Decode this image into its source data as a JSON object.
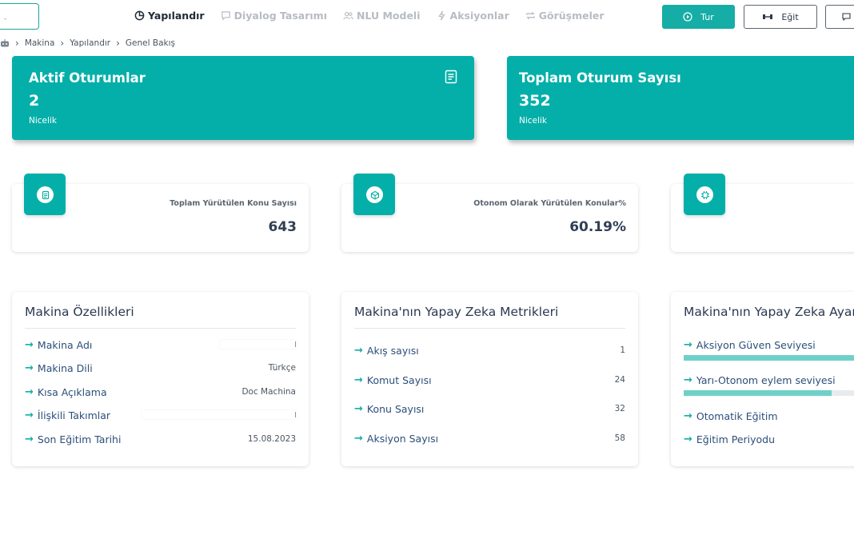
{
  "top_input": {
    "value": "-"
  },
  "nav": {
    "items": [
      {
        "label": "Yapılandır",
        "icon": "pie-chart-icon",
        "active": true
      },
      {
        "label": "Diyalog Tasarımı",
        "icon": "chat-bubble-icon",
        "active": false
      },
      {
        "label": "NLU Modeli",
        "icon": "users-icon",
        "active": false
      },
      {
        "label": "Aksiyonlar",
        "icon": "lightning-icon",
        "active": false
      },
      {
        "label": "Görüşmeler",
        "icon": "repeat-icon",
        "active": false
      }
    ]
  },
  "toolbar": {
    "run_label": "Tur",
    "train_label": "Eğit"
  },
  "breadcrumb": [
    "Makina",
    "Yapılandır",
    "Genel Bakış"
  ],
  "stats": [
    {
      "title": "Aktif Oturumlar",
      "value": "2",
      "unit": "Nicelik"
    },
    {
      "title": "Toplam Oturum Sayısı",
      "value": "352",
      "unit": "Nicelik"
    }
  ],
  "metrics": [
    {
      "label": "Toplam Yürütülen Konu Sayısı",
      "value": "643",
      "icon": "document-icon"
    },
    {
      "label": "Otonom Olarak Yürütülen Konular%",
      "value": "60.19%",
      "icon": "cube-icon"
    },
    {
      "label": "",
      "value": "",
      "icon": "chip-icon"
    }
  ],
  "properties": {
    "title": "Makina Özellikleri",
    "rows": [
      {
        "label": "Makina Adı",
        "value": ""
      },
      {
        "label": "Makina Dili",
        "value": "Türkçe"
      },
      {
        "label": "Kısa Açıklama",
        "value": "Doc Machina"
      },
      {
        "label": "İlişkili Takımlar",
        "value": ""
      },
      {
        "label": "Son Eğitim Tarihi",
        "value": "15.08.2023"
      }
    ]
  },
  "ai_metrics": {
    "title": "Makina'nın Yapay Zeka Metrikleri",
    "rows": [
      {
        "label": "Akış sayısı",
        "value": "1"
      },
      {
        "label": "Komut Sayısı",
        "value": "24"
      },
      {
        "label": "Konu Sayısı",
        "value": "32"
      },
      {
        "label": "Aksiyon Sayısı",
        "value": "58"
      }
    ]
  },
  "ai_settings": {
    "title": "Makina'nın Yapay Zeka Ayarları",
    "rows": [
      {
        "label": "Aksiyon Güven Seviyesi",
        "level": 1.0
      },
      {
        "label": "Yarı-Otonom eylem seviyesi",
        "level": 0.81
      },
      {
        "label": "Otomatik Eğitim"
      },
      {
        "label": "Eğitim Periyodu"
      }
    ]
  },
  "colors": {
    "accent": "#04afa9",
    "bar_fill": "#6fd0ca",
    "link": "#2b4f7a"
  }
}
